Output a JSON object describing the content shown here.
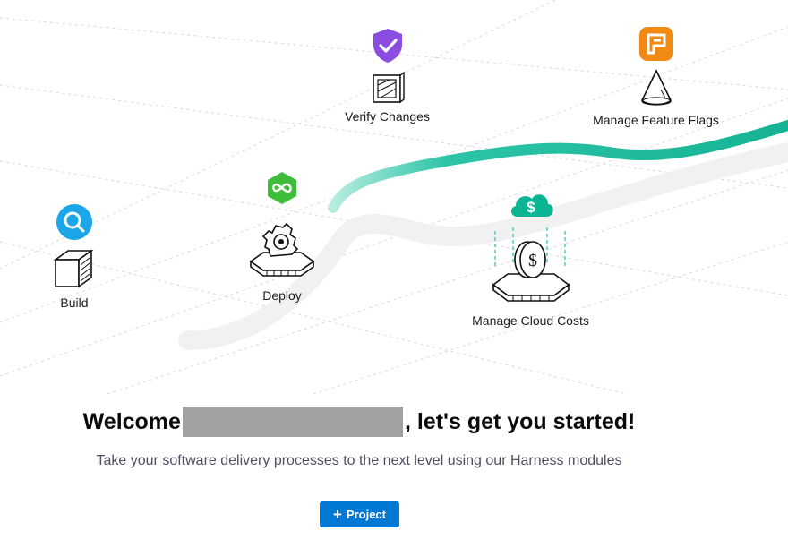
{
  "modules": [
    {
      "id": "build",
      "label": "Build",
      "badge_icon": "search-icon",
      "badge_color": "#1aa6e8"
    },
    {
      "id": "deploy",
      "label": "Deploy",
      "badge_icon": "infinity-loop-icon",
      "badge_color": "#3dbd3a"
    },
    {
      "id": "verify",
      "label": "Verify Changes",
      "badge_icon": "shield-check-icon",
      "badge_color": "#8a4ddf"
    },
    {
      "id": "cloud",
      "label": "Manage Cloud Costs",
      "badge_icon": "cloud-dollar-icon",
      "badge_color": "#0bb594"
    },
    {
      "id": "flags",
      "label": "Manage Feature Flags",
      "badge_icon": "flag-icon",
      "badge_color": "#f08a12"
    }
  ],
  "welcome": {
    "prefix": "Welcome",
    "suffix": ", let's get you started!",
    "subtitle": "Take your software delivery processes to the next level using our Harness modules"
  },
  "project_button": {
    "label": "Project",
    "icon": "plus-icon",
    "color": "#0278d5"
  }
}
